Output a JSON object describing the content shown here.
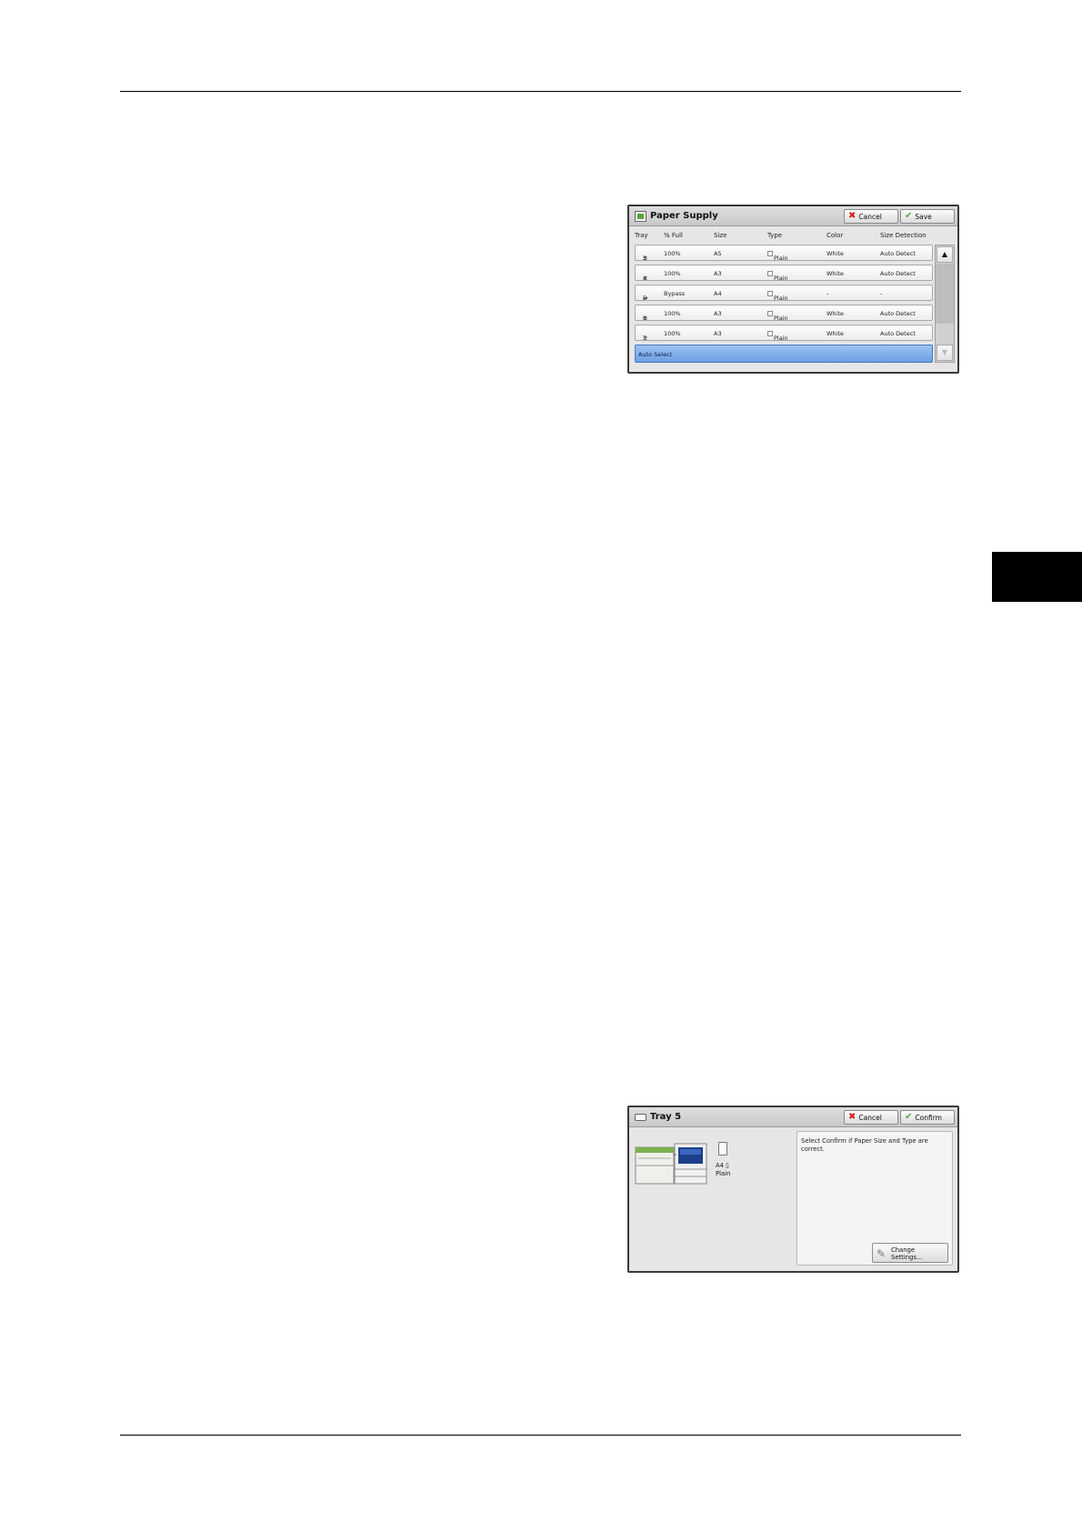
{
  "paper_supply": {
    "title": "Paper Supply",
    "cancel_label": "Cancel",
    "save_label": "Save",
    "columns": {
      "tray": "Tray",
      "full": "% Full",
      "size": "Size",
      "type": "Type",
      "color": "Color",
      "detection": "Size Detection"
    },
    "rows": [
      {
        "tray": "3",
        "full": "100%",
        "size": "A5",
        "type": "Plain",
        "color": "White",
        "detection": "Auto Detect"
      },
      {
        "tray": "4",
        "full": "100%",
        "size": "A3",
        "type": "Plain",
        "color": "White",
        "detection": "Auto Detect"
      },
      {
        "tray": "5",
        "full": "Bypass",
        "size": "A4",
        "type": "Plain",
        "color": "-",
        "detection": "-"
      },
      {
        "tray": "6",
        "full": "100%",
        "size": "A3",
        "type": "Plain",
        "color": "White",
        "detection": "Auto Detect"
      },
      {
        "tray": "7",
        "full": "100%",
        "size": "A3",
        "type": "Plain",
        "color": "White",
        "detection": "Auto Detect"
      }
    ],
    "auto_select_label": "Auto Select",
    "scroll_up": "▲",
    "scroll_down": "▼"
  },
  "tray5": {
    "title": "Tray 5",
    "cancel_label": "Cancel",
    "confirm_label": "Confirm",
    "message": "Select Confirm if Paper Size and Type are correct.",
    "paper_size": "A4",
    "paper_type": "Plain",
    "change_settings_label": "Change\nSettings..."
  },
  "colors": {
    "selected_row": "#6c9fe4",
    "cancel_icon": "#d42020",
    "ok_icon": "#5aa33a"
  }
}
